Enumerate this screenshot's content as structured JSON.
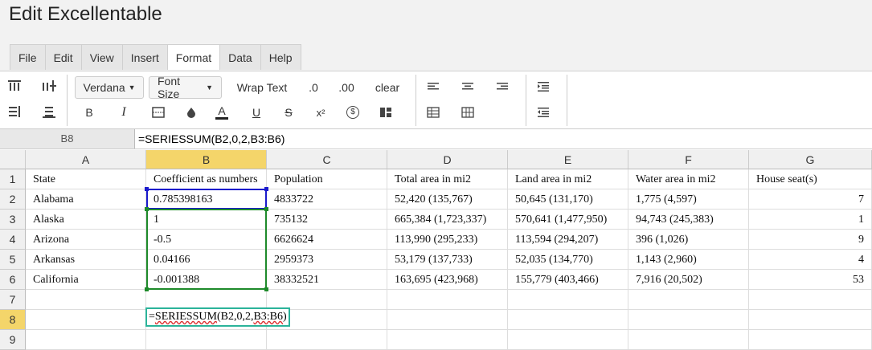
{
  "app": {
    "title": "Edit Excellentable"
  },
  "menu": [
    "File",
    "Edit",
    "View",
    "Insert",
    "Format",
    "Data",
    "Help"
  ],
  "menu_active": "Format",
  "toolbar": {
    "font": "Verdana",
    "font_size": "Font Size",
    "wrap_text": "Wrap Text",
    "dec_less": ".0",
    "dec_more": ".00",
    "clear": "clear",
    "bold": "B",
    "italic": "I",
    "text_color": "A",
    "underline": "U",
    "strike": "S",
    "superscript": "x²",
    "currency": "$"
  },
  "formula_bar": {
    "cell_ref": "B8",
    "formula": "=SERIESSUM(B2,0,2,B3:B6)"
  },
  "columns": [
    "A",
    "B",
    "C",
    "D",
    "E",
    "F",
    "G"
  ],
  "selected_column": "B",
  "rows": [
    {
      "n": "1",
      "cells": [
        "State",
        "Coefficient as numbers",
        "Population",
        "Total area in mi2",
        "Land area in mi2",
        "Water area in mi2",
        "House seat(s)"
      ]
    },
    {
      "n": "2",
      "cells": [
        "Alabama",
        "0.785398163",
        "4833722",
        "52,420 (135,767)",
        "50,645 (131,170)",
        "1,775 (4,597)",
        "7"
      ]
    },
    {
      "n": "3",
      "cells": [
        "Alaska",
        "1",
        "735132",
        "665,384 (1,723,337)",
        "570,641 (1,477,950)",
        "94,743 (245,383)",
        "1"
      ]
    },
    {
      "n": "4",
      "cells": [
        "Arizona",
        "-0.5",
        "6626624",
        "113,990 (295,233)",
        "113,594 (294,207)",
        "396 (1,026)",
        "9"
      ]
    },
    {
      "n": "5",
      "cells": [
        "Arkansas",
        "0.04166",
        "2959373",
        "53,179 (137,733)",
        "52,035 (134,770)",
        "1,143 (2,960)",
        "4"
      ]
    },
    {
      "n": "6",
      "cells": [
        "California",
        "-0.001388",
        "38332521",
        "163,695 (423,968)",
        "155,779 (403,466)",
        "7,916 (20,502)",
        "53"
      ]
    },
    {
      "n": "7",
      "cells": [
        "",
        "",
        "",
        "",
        "",
        "",
        ""
      ]
    },
    {
      "n": "8",
      "cells": [
        "",
        "",
        "",
        "",
        "",
        "",
        ""
      ]
    },
    {
      "n": "9",
      "cells": [
        "",
        "",
        "",
        "",
        "",
        "",
        ""
      ]
    }
  ],
  "selected_row": "8",
  "editor": {
    "prefix": "=",
    "func": "SERIESSUM",
    "args": "(B2,0,2,",
    "range": "B3:B6",
    "close": ")"
  },
  "colors": {
    "highlight": "#f4d56a",
    "ref_blue": "#1a1acc",
    "ref_green": "#1e8a2a",
    "editor_border": "#2bb39a"
  }
}
